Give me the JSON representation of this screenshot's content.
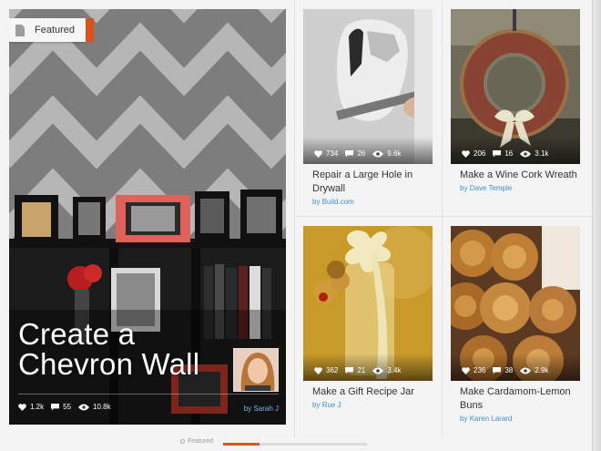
{
  "featured": {
    "tag_label": "Featured",
    "tag_icon": "document-icon",
    "title": "Create a Chevron Wall",
    "likes": "1.2k",
    "comments": "55",
    "views": "10.8k",
    "by_prefix": "by",
    "author": "Sarah J"
  },
  "cards": [
    {
      "title": "Repair a Large Hole in Drywall",
      "likes": "734",
      "comments": "26",
      "views": "9.6k",
      "by_prefix": "by",
      "author": "Build.com"
    },
    {
      "title": "Make a Wine Cork Wreath",
      "likes": "206",
      "comments": "16",
      "views": "3.1k",
      "by_prefix": "by",
      "author": "Dave Temple"
    },
    {
      "title": "Make a Gift Recipe Jar",
      "likes": "362",
      "comments": "21",
      "views": "3.4k",
      "by_prefix": "by",
      "author": "Rue J"
    },
    {
      "title": "Make Cardamom-Lemon Buns",
      "likes": "236",
      "comments": "38",
      "views": "2.9k",
      "by_prefix": "by",
      "author": "Karen Larard"
    }
  ],
  "pager": {
    "label": "Featured",
    "progress": 0.25
  },
  "colors": {
    "accent": "#d9541a",
    "link": "#3d8fd6",
    "text": "#333333"
  }
}
